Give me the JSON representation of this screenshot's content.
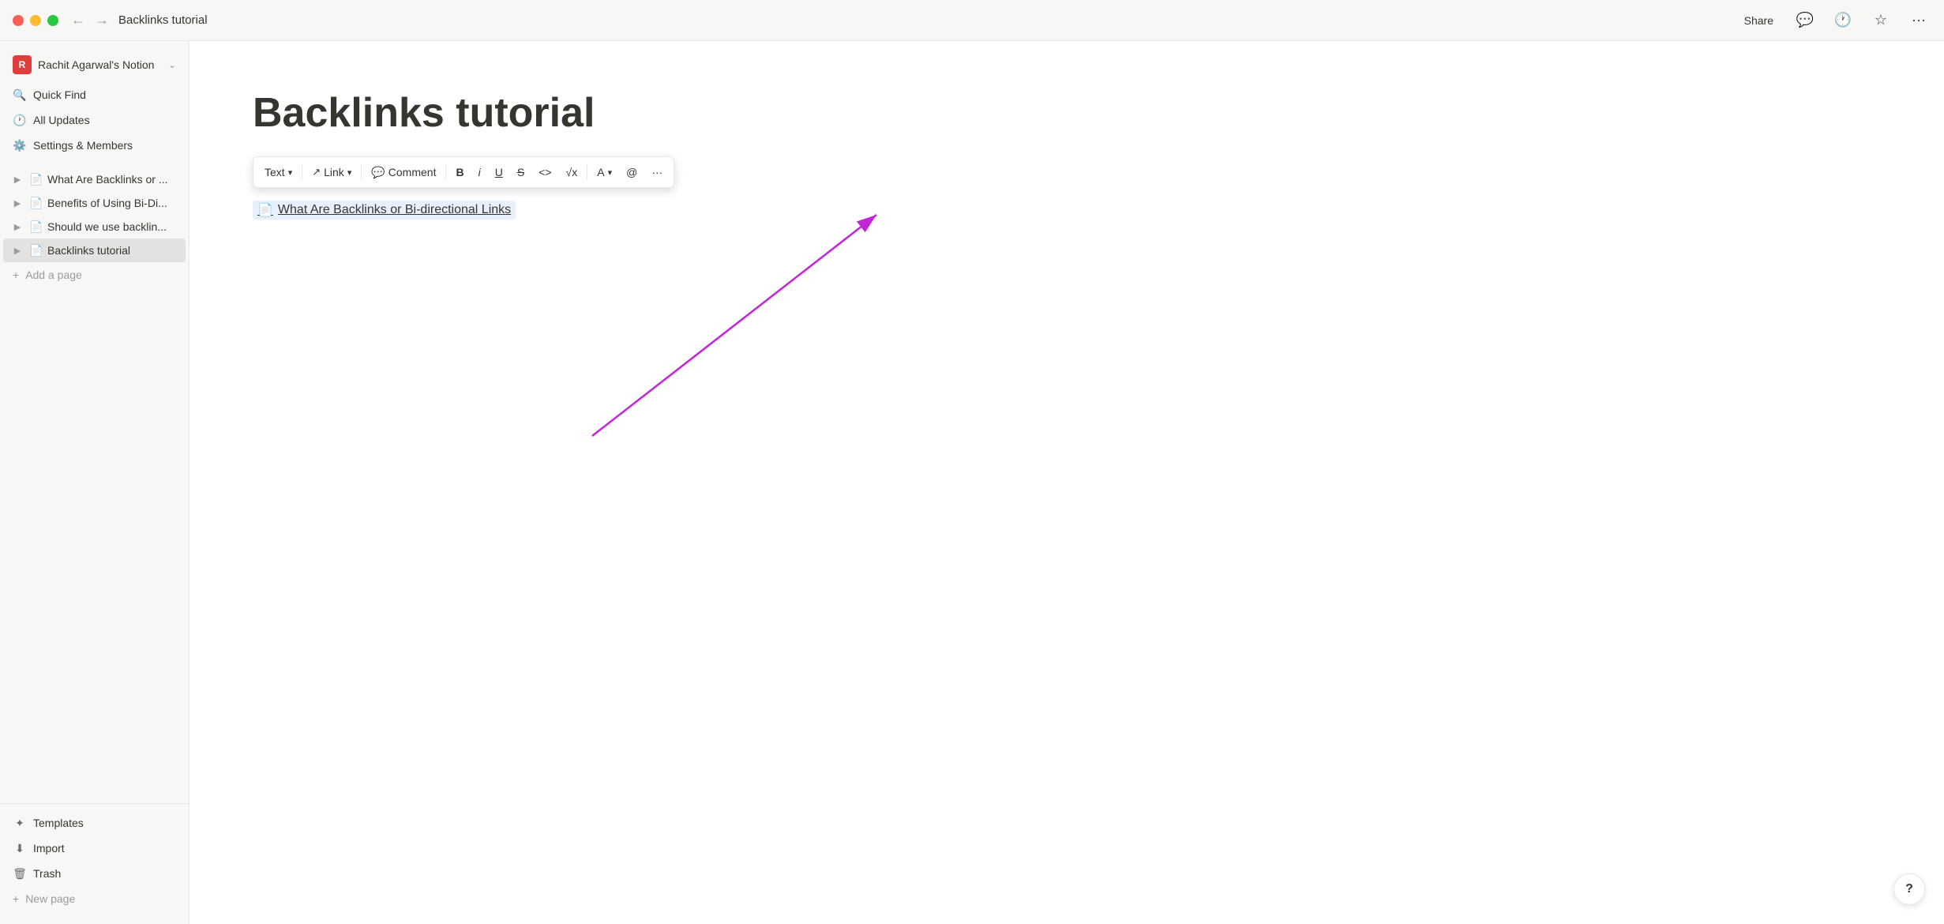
{
  "titlebar": {
    "title": "Backlinks tutorial",
    "share_label": "Share",
    "back_arrow": "←",
    "forward_arrow": "→"
  },
  "sidebar": {
    "workspace": {
      "initial": "R",
      "name": "Rachit Agarwal's Notion",
      "chevron": "⌄"
    },
    "nav_items": [
      {
        "id": "quick-find",
        "icon": "🔍",
        "label": "Quick Find"
      },
      {
        "id": "all-updates",
        "icon": "🕐",
        "label": "All Updates"
      },
      {
        "id": "settings",
        "icon": "⚙️",
        "label": "Settings & Members"
      }
    ],
    "pages": [
      {
        "id": "page1",
        "label": "What Are Backlinks or ...",
        "active": false
      },
      {
        "id": "page2",
        "label": "Benefits of Using Bi-Di...",
        "active": false
      },
      {
        "id": "page3",
        "label": "Should we use backlin...",
        "active": false
      },
      {
        "id": "page4",
        "label": "Backlinks tutorial",
        "active": true
      }
    ],
    "add_page_label": "Add a page",
    "bottom_items": [
      {
        "id": "templates",
        "icon": "✦",
        "label": "Templates"
      },
      {
        "id": "import",
        "icon": "⬇",
        "label": "Import"
      },
      {
        "id": "trash",
        "icon": "🗑",
        "label": "Trash"
      }
    ],
    "new_page_label": "New page"
  },
  "page": {
    "title": "Backlinks tutorial",
    "page_link_text": "What Are Backlinks or Bi-directional Links",
    "page_link_icon": "📄"
  },
  "toolbar": {
    "text_label": "Text",
    "link_label": "Link",
    "comment_label": "Comment",
    "bold_label": "B",
    "italic_label": "i",
    "underline_label": "U",
    "strikethrough_label": "S",
    "code_label": "<>",
    "math_label": "√x",
    "color_label": "A",
    "mention_label": "@",
    "more_label": "···"
  },
  "help": {
    "label": "?"
  }
}
